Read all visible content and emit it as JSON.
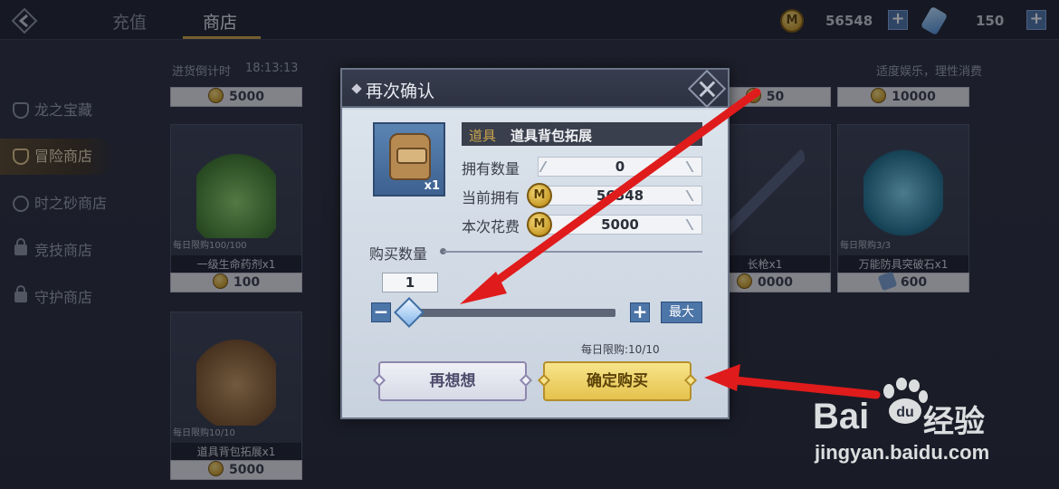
{
  "top_tabs": [
    {
      "label": "充值",
      "active": false
    },
    {
      "label": "商店",
      "active": true
    }
  ],
  "currencies": [
    {
      "icon": "gold-coin-icon",
      "value": "56548"
    },
    {
      "icon": "blue-gem-icon",
      "value": "150"
    }
  ],
  "sidebar": {
    "items": [
      {
        "label": "龙之宝藏",
        "active": false,
        "locked": false
      },
      {
        "label": "冒险商店",
        "active": true,
        "locked": false
      },
      {
        "label": "时之砂商店",
        "active": false,
        "locked": false
      },
      {
        "label": "竞技商店",
        "active": false,
        "locked": true
      },
      {
        "label": "守护商店",
        "active": false,
        "locked": true
      }
    ]
  },
  "shop": {
    "restock_label": "进货倒计时",
    "restock_time": "18:13:13",
    "notice": "适度娱乐，理性消费",
    "top_prices": [
      "5000",
      "50",
      "10000"
    ],
    "cards": [
      {
        "name": "一级生命药剂x1",
        "limit": "每日限购100/100",
        "price": "100",
        "currency": "coin"
      },
      {
        "name": "长枪x1",
        "limit": "",
        "price": "0000",
        "currency": "coin"
      },
      {
        "name": "万能防具突破石x1",
        "limit": "每日限购3/3",
        "price": "600",
        "currency": "scroll"
      },
      {
        "name": "道具背包拓展x1",
        "limit": "每日限购10/10",
        "price": "5000",
        "currency": "coin"
      }
    ]
  },
  "dialog": {
    "title": "再次确认",
    "item_type": "道具",
    "item_name": "道具背包拓展",
    "item_count": "x1",
    "owned_label": "拥有数量",
    "owned_value": "0",
    "current_label": "当前拥有",
    "current_value": "56548",
    "cost_label": "本次花费",
    "cost_value": "5000",
    "coin_glyph": "M",
    "qty_label": "购买数量",
    "qty_value": "1",
    "minus_label": "−",
    "plus_label": "+",
    "max_label": "最大",
    "daily_limit": "每日限购:10/10",
    "cancel_label": "再想想",
    "confirm_label": "确定购买"
  },
  "watermark": {
    "logo": "Bai",
    "logo_suffix": "du",
    "text": "经验",
    "url": "jingyan.baidu.com"
  },
  "colors": {
    "accent_gold": "#c9a44a",
    "button_blue": "#4c75a8",
    "confirm_yellow": "#f0d35f",
    "annotation_red": "#e01b1b"
  }
}
